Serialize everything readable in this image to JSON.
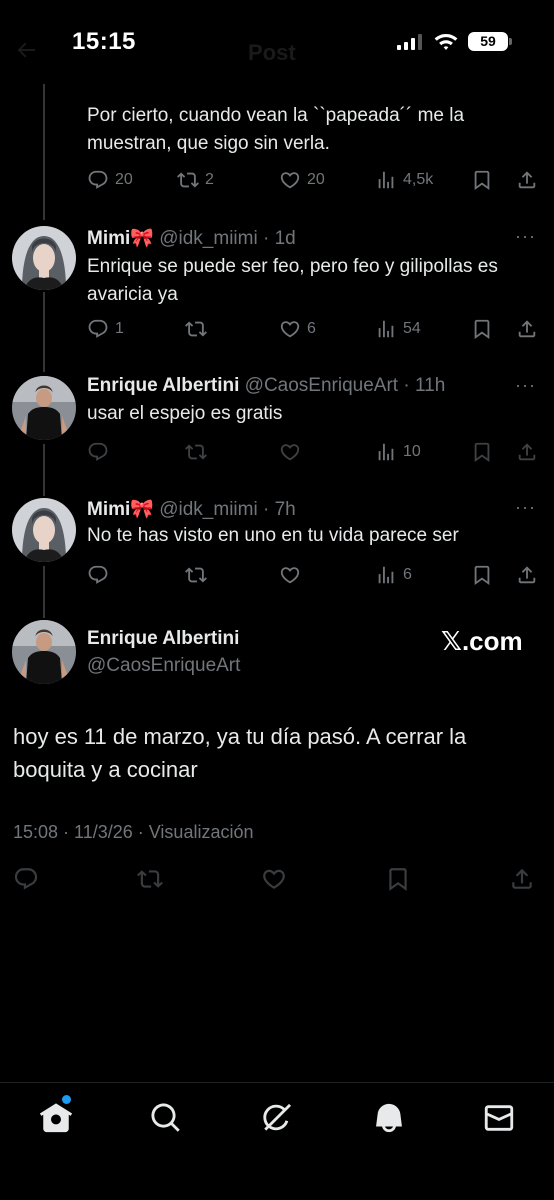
{
  "status_bar": {
    "time": "15:15",
    "battery": "59",
    "header_title": "Post"
  },
  "tweets": [
    {
      "text": "Por cierto, cuando vean la ``papeada´´ me la muestran, que sigo sin verla.",
      "replies": "20",
      "retweets": "2",
      "likes": "20",
      "views": "4,5k"
    },
    {
      "name": "Mimi🎀",
      "handle": "@idk_miimi",
      "time": "· 1d",
      "text": "Enrique se puede ser feo, pero feo y gilipollas es avaricia ya",
      "replies": "1",
      "retweets": "",
      "likes": "6",
      "views": "54"
    },
    {
      "name": "Enrique Albertini",
      "handle": "@CaosEnriqueArt",
      "time": "· 11h",
      "text": "usar el espejo es gratis",
      "replies": "",
      "retweets": "",
      "likes": "",
      "views": "10"
    },
    {
      "name": "Mimi🎀",
      "handle": "@idk_miimi",
      "time": "· 7h",
      "text": "No te has visto en uno en tu vida parece ser",
      "replies": "",
      "retweets": "",
      "likes": "",
      "views": "6"
    }
  ],
  "main_tweet": {
    "name": "Enrique Albertini",
    "handle": "@CaosEnriqueArt",
    "watermark": "𝕏.com",
    "text": "hoy es 11 de marzo, ya tu día pasó. A cerrar la boquita y a cocinar",
    "meta": "15:08 · 11/3/26 · Visualización"
  },
  "more_label": "···",
  "nav": [
    "home-icon",
    "search-icon",
    "grok-icon",
    "notifications-icon",
    "messages-icon"
  ],
  "colors": {
    "background": "#000000",
    "text": "#e7e9ea",
    "muted": "#71767b",
    "accent": "#1d9bf0"
  }
}
